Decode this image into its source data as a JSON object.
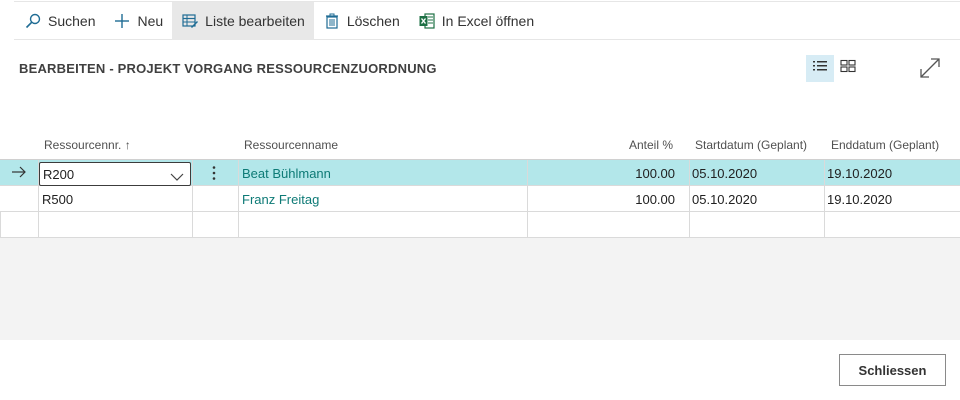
{
  "toolbar": {
    "search_label": "Suchen",
    "new_label": "Neu",
    "edit_list_label": "Liste bearbeiten",
    "delete_label": "Löschen",
    "excel_label": "In Excel öffnen"
  },
  "page": {
    "title": "BEARBEITEN - PROJEKT VORGANG RESSOURCENZUORDNUNG"
  },
  "table": {
    "columns": {
      "resource_no": "Ressourcennr.",
      "resource_no_sort": "↑",
      "resource_name": "Ressourcenname",
      "share": "Anteil %",
      "start_date": "Startdatum (Geplant)",
      "end_date": "Enddatum (Geplant)"
    },
    "rows": [
      {
        "resource_no": "R200",
        "resource_name": "Beat Bühlmann",
        "share": "100.00",
        "start_date": "05.10.2020",
        "end_date": "19.10.2020"
      },
      {
        "resource_no": "R500",
        "resource_name": "Franz Freitag",
        "share": "100.00",
        "start_date": "05.10.2020",
        "end_date": "19.10.2020"
      }
    ]
  },
  "footer": {
    "close_label": "Schliessen"
  },
  "colors": {
    "selected_row": "#b3e7ea",
    "link": "#0d7a76",
    "excel_green": "#1d7044",
    "accent_blue": "#1f6c94"
  }
}
